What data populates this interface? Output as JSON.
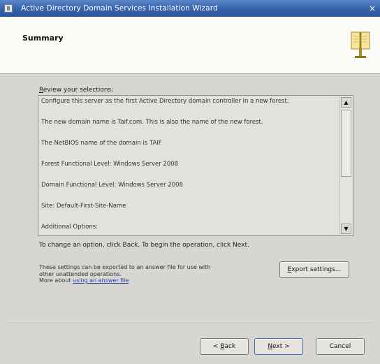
{
  "window": {
    "title": "Active Directory Domain Services Installation Wizard",
    "close_glyph": "×"
  },
  "header": {
    "title": "Summary",
    "icon": "book-icon"
  },
  "review": {
    "label_accel": "R",
    "label_rest": "eview your selections:"
  },
  "summary_lines": [
    "Configure this server as the first Active Directory domain controller in a new forest.",
    "The new domain name is Taif.com. This is also the name of the new forest.",
    "The NetBIOS name of the domain is TAIF",
    "Forest Functional Level: Windows Server 2008",
    "Domain Functional Level: Windows Server 2008",
    "Site: Default-First-Site-Name",
    "Additional Options:"
  ],
  "scrollbar": {
    "up_glyph": "▲",
    "down_glyph": "▼"
  },
  "change_text": "To change an option, click Back. To begin the operation, click Next.",
  "export": {
    "text_line1": "These settings can be exported to an answer file for use with",
    "text_line2": "other unattended operations.",
    "more_prefix": "More about ",
    "more_link": "using an answer file",
    "button_accel": "E",
    "button_rest": "xport settings..."
  },
  "buttons": {
    "back_prefix": "< ",
    "back_accel": "B",
    "back_rest": "ack",
    "next_accel": "N",
    "next_rest": "ext >",
    "cancel": "Cancel"
  },
  "colors": {
    "titlebar": "#3462ab",
    "link": "#2b3fb0",
    "dialog_bg": "#d8d6d1"
  }
}
